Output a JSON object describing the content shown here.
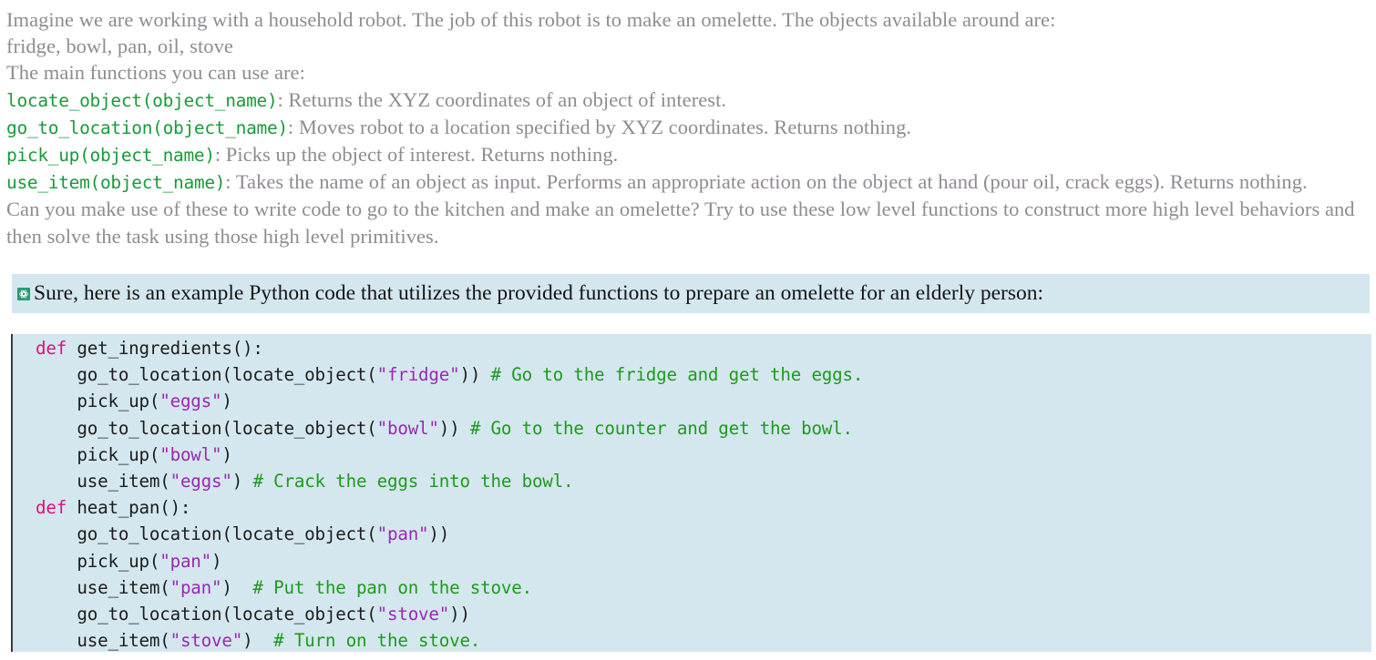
{
  "prompt": {
    "intro": "Imagine we are working with a household robot. The job of this robot is to make an omelette. The objects available around are:",
    "objects": "fridge, bowl, pan, oil, stove",
    "functions_heading": "The main functions you can use are:",
    "functions": [
      {
        "signature": "locate_object(object_name)",
        "description": ": Returns the XYZ coordinates of an object of interest."
      },
      {
        "signature": "go_to_location(object_name)",
        "description": ": Moves robot to a location specified by XYZ coordinates. Returns nothing."
      },
      {
        "signature": "pick_up(object_name)",
        "description": ": Picks up the object of interest. Returns nothing."
      },
      {
        "signature": "use_item(object_name)",
        "description": ": Takes the name of an object as input. Performs an appropriate action on the object at hand (pour oil, crack eggs). Returns nothing."
      }
    ],
    "question": "Can you make use of these to write code to go to the kitchen and make an omelette? Try to use these low level functions to construct more high level behaviors and then solve the task using those high level primitives."
  },
  "response": {
    "icon": "chatgpt-logo-icon",
    "text": "Sure, here is an example Python code that utilizes the provided functions to prepare an omelette for an elderly person:"
  },
  "code": {
    "language": "python",
    "lines": [
      {
        "indent": "",
        "segments": [
          {
            "t": "kw",
            "v": "def"
          },
          {
            "t": "plain",
            "v": " get_ingredients():"
          }
        ]
      },
      {
        "indent": "    ",
        "segments": [
          {
            "t": "plain",
            "v": "go_to_location(locate_object("
          },
          {
            "t": "str",
            "v": "\"fridge\""
          },
          {
            "t": "plain",
            "v": ")) "
          },
          {
            "t": "cm",
            "v": "# Go to the fridge and get the eggs."
          }
        ]
      },
      {
        "indent": "    ",
        "segments": [
          {
            "t": "plain",
            "v": "pick_up("
          },
          {
            "t": "str",
            "v": "\"eggs\""
          },
          {
            "t": "plain",
            "v": ")"
          }
        ]
      },
      {
        "indent": "    ",
        "segments": [
          {
            "t": "plain",
            "v": "go_to_location(locate_object("
          },
          {
            "t": "str",
            "v": "\"bowl\""
          },
          {
            "t": "plain",
            "v": ")) "
          },
          {
            "t": "cm",
            "v": "# Go to the counter and get the bowl."
          }
        ]
      },
      {
        "indent": "    ",
        "segments": [
          {
            "t": "plain",
            "v": "pick_up("
          },
          {
            "t": "str",
            "v": "\"bowl\""
          },
          {
            "t": "plain",
            "v": ")"
          }
        ]
      },
      {
        "indent": "    ",
        "segments": [
          {
            "t": "plain",
            "v": "use_item("
          },
          {
            "t": "str",
            "v": "\"eggs\""
          },
          {
            "t": "plain",
            "v": ") "
          },
          {
            "t": "cm",
            "v": "# Crack the eggs into the bowl."
          }
        ]
      },
      {
        "indent": "",
        "segments": [
          {
            "t": "kw",
            "v": "def"
          },
          {
            "t": "plain",
            "v": " heat_pan():"
          }
        ]
      },
      {
        "indent": "    ",
        "segments": [
          {
            "t": "plain",
            "v": "go_to_location(locate_object("
          },
          {
            "t": "str",
            "v": "\"pan\""
          },
          {
            "t": "plain",
            "v": "))"
          }
        ]
      },
      {
        "indent": "    ",
        "segments": [
          {
            "t": "plain",
            "v": "pick_up("
          },
          {
            "t": "str",
            "v": "\"pan\""
          },
          {
            "t": "plain",
            "v": ")"
          }
        ]
      },
      {
        "indent": "    ",
        "segments": [
          {
            "t": "plain",
            "v": "use_item("
          },
          {
            "t": "str",
            "v": "\"pan\""
          },
          {
            "t": "plain",
            "v": ")  "
          },
          {
            "t": "cm",
            "v": "# Put the pan on the stove."
          }
        ]
      },
      {
        "indent": "    ",
        "segments": [
          {
            "t": "plain",
            "v": "go_to_location(locate_object("
          },
          {
            "t": "str",
            "v": "\"stove\""
          },
          {
            "t": "plain",
            "v": "))"
          }
        ]
      },
      {
        "indent": "    ",
        "segments": [
          {
            "t": "plain",
            "v": "use_item("
          },
          {
            "t": "str",
            "v": "\"stove\""
          },
          {
            "t": "plain",
            "v": ")  "
          },
          {
            "t": "cm",
            "v": "# Turn on the stove."
          }
        ]
      }
    ]
  },
  "colors": {
    "prompt_text": "#8f8b90",
    "function_name": "#1a9a3c",
    "panel_background": "#d4e7ee",
    "keyword": "#e0107c",
    "string": "#9a28b4",
    "comment": "#1d9a1d",
    "code_text": "#1c1c1c"
  }
}
